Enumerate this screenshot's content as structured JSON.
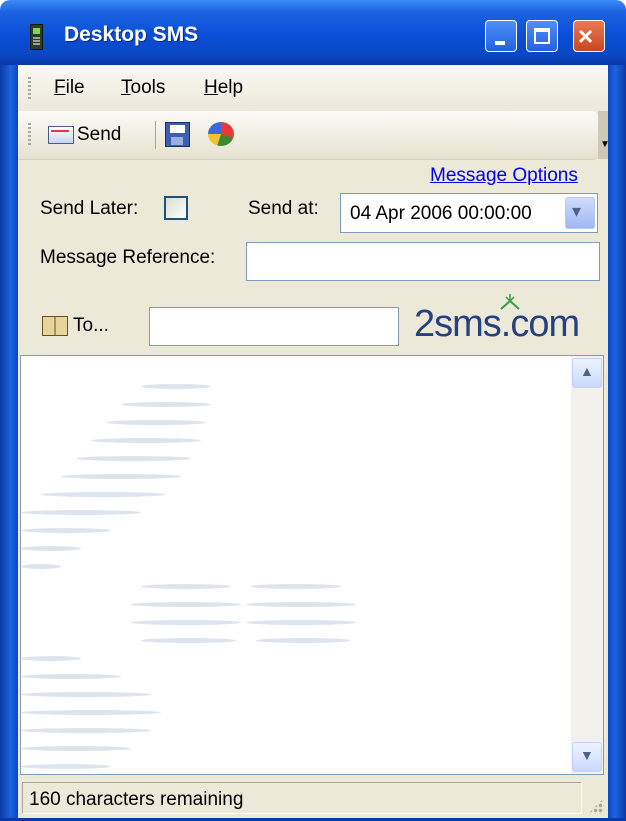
{
  "window": {
    "title": "Desktop SMS",
    "minimize_label": "_",
    "maximize_label": "□",
    "close_label": "×"
  },
  "menu": [
    {
      "underline": "F",
      "rest": "ile"
    },
    {
      "underline": "T",
      "rest": "ools"
    },
    {
      "underline": "H",
      "rest": "elp"
    }
  ],
  "toolbar": {
    "send_label": "Send",
    "icons": [
      "send-icon",
      "save-icon",
      "chart-icon"
    ]
  },
  "options": {
    "message_options_link": "Message Options",
    "send_later_label": "Send Later:",
    "send_later_checked": false,
    "send_at_label": "Send at:",
    "send_at_value": "04 Apr 2006  00:00:00",
    "message_reference_label": "Message Reference:",
    "message_reference_value": ""
  },
  "recipients": {
    "to_label": "To...",
    "to_value": ""
  },
  "logo": {
    "text": "2sms.com"
  },
  "message": {
    "body": ""
  },
  "status": {
    "text": "160 characters remaining"
  },
  "colors": {
    "titlebar": "#0a4fd8",
    "client": "#ece9d8",
    "link": "#0000ee",
    "logo": "#27407f"
  }
}
